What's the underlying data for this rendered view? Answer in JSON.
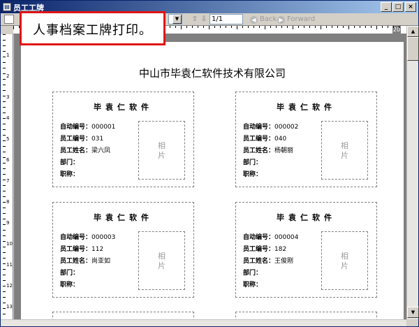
{
  "window": {
    "title": "员工工牌",
    "app_icon": "report-window-icon",
    "controls": {
      "minimize": "_",
      "maximize": "□",
      "close": "×"
    }
  },
  "toolbar": {
    "page_field": "1/1",
    "back_label": "Back",
    "forward_label": "Forward",
    "icons": [
      "page-setup-icon",
      "dropdown-icon",
      "nav-up-icon",
      "nav-down-icon",
      "back-icon",
      "forward-icon"
    ]
  },
  "ruler": {
    "marker": "20"
  },
  "callout": {
    "text": "人事档案工牌打印。"
  },
  "report": {
    "company": "中山市毕袁仁软件技术有限公司",
    "cards": [
      {
        "title": "毕袁仁软件",
        "auto_no_label": "自动编号：",
        "auto_no": "000001",
        "emp_no_label": "员工编号：",
        "emp_no": "031",
        "name_label": "员工姓名：",
        "name": "梁六凤",
        "dept_label": "部门：",
        "dept": "",
        "title_label": "职称：",
        "job_title": "",
        "photo_label": "相片"
      },
      {
        "title": "毕袁仁软件",
        "auto_no_label": "自动编号：",
        "auto_no": "000002",
        "emp_no_label": "员工编号：",
        "emp_no": "040",
        "name_label": "员工姓名：",
        "name": "杨朝丽",
        "dept_label": "部门：",
        "dept": "",
        "title_label": "职称：",
        "job_title": "",
        "photo_label": "相片"
      },
      {
        "title": "毕袁仁软件",
        "auto_no_label": "自动编号：",
        "auto_no": "000003",
        "emp_no_label": "员工编号：",
        "emp_no": "112",
        "name_label": "员工姓名：",
        "name": "尚亚如",
        "dept_label": "部门：",
        "dept": "",
        "title_label": "职称：",
        "job_title": "",
        "photo_label": "相片"
      },
      {
        "title": "毕袁仁软件",
        "auto_no_label": "自动编号：",
        "auto_no": "000004",
        "emp_no_label": "员工编号：",
        "emp_no": "182",
        "name_label": "员工姓名：",
        "name": "王俊刚",
        "dept_label": "部门：",
        "dept": "",
        "title_label": "职称：",
        "job_title": "",
        "photo_label": "相片"
      }
    ]
  },
  "colors": {
    "callout_border": "#e01515",
    "titlebar": "#0a246a",
    "canvas": "#808080"
  }
}
